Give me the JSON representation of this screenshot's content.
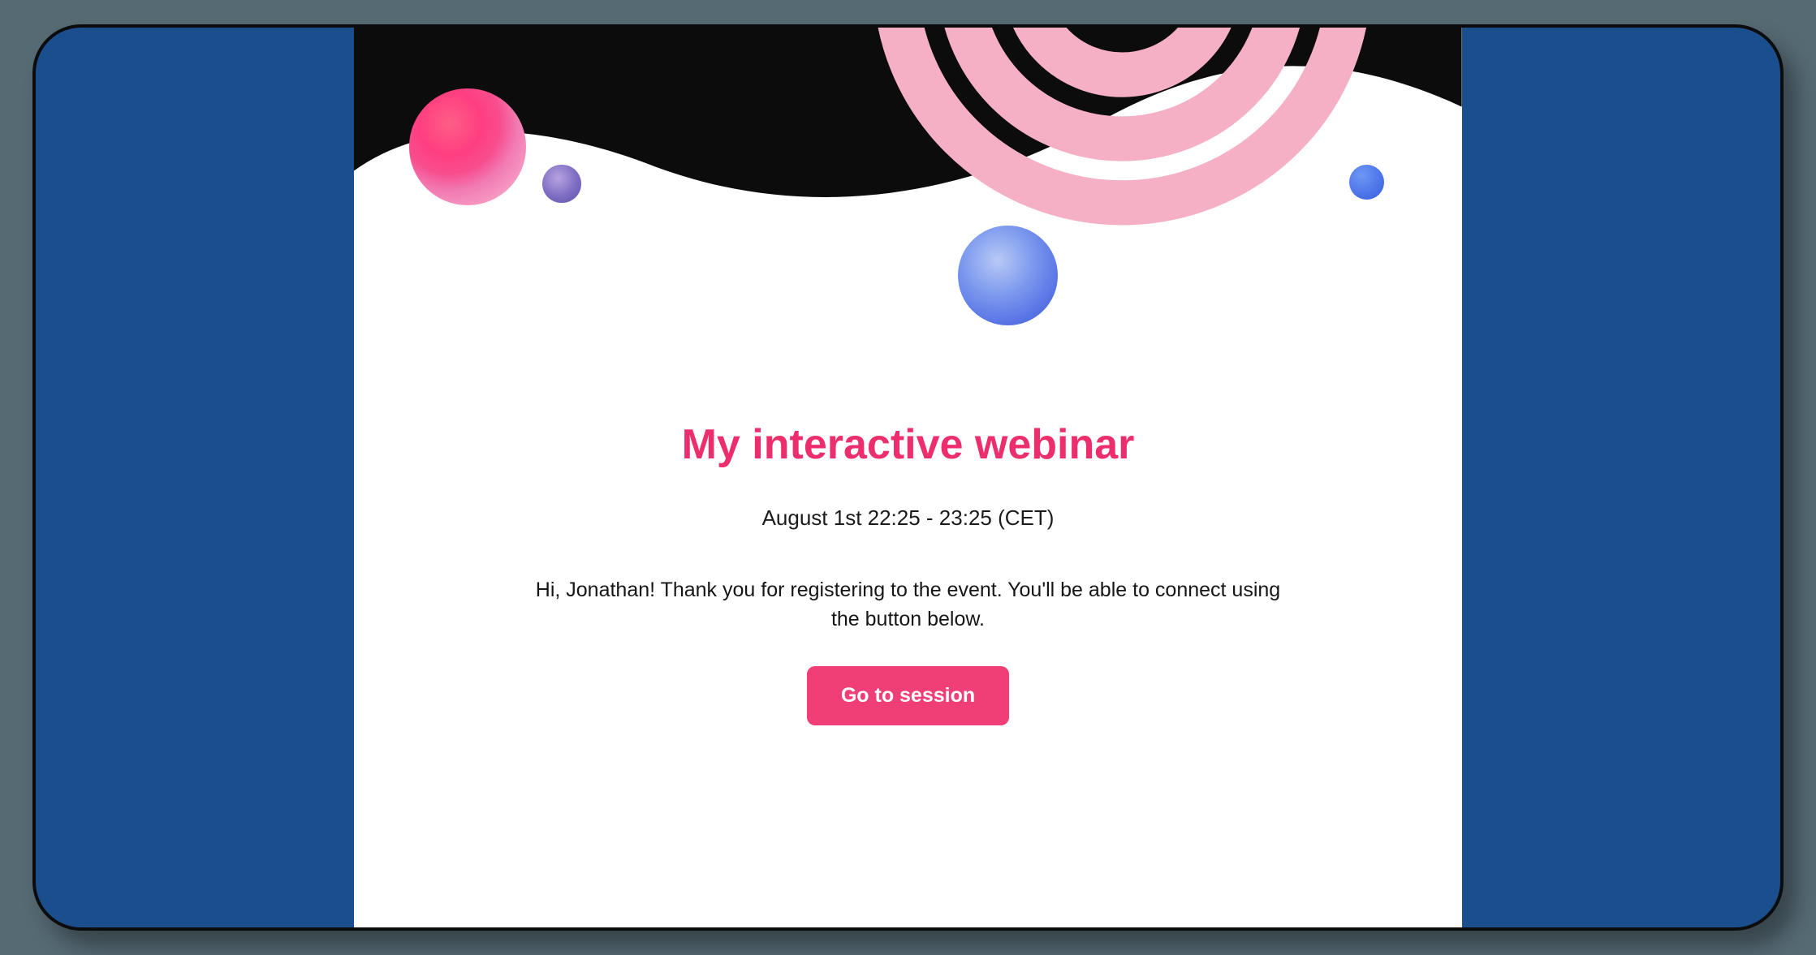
{
  "event": {
    "title": "My interactive webinar",
    "datetime": "August 1st 22:25 - 23:25 (CET)",
    "message": "Hi, Jonathan! Thank you for registering to the event. You'll be able to connect using the button below.",
    "cta_label": "Go to session"
  },
  "colors": {
    "accent": "#ec2f6c",
    "cta_bg": "#f03f76",
    "frame_bg": "#1b4e8c",
    "page_bg": "#566a74"
  }
}
